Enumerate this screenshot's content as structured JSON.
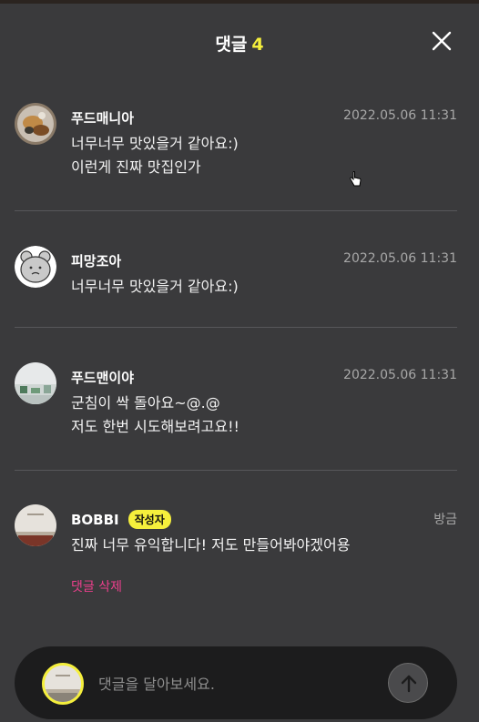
{
  "header": {
    "title": "댓글",
    "count": "4"
  },
  "comments": [
    {
      "author": "푸드매니아",
      "time": "2022.05.06 11:31",
      "lines": [
        "너무너무 맛있을거 같아요:)",
        "이런게 진짜 맛집인가"
      ],
      "avatar": "food-photo"
    },
    {
      "author": "피망조아",
      "time": "2022.05.06 11:31",
      "lines": [
        "너무너무 맛있을거 같아요:)"
      ],
      "avatar": "bear-character"
    },
    {
      "author": "푸드맨이야",
      "time": "2022.05.06 11:31",
      "lines": [
        "군침이 싹 돌아요~@.@",
        "저도 한번 시도해보려고요!!"
      ],
      "avatar": "kitchen-photo"
    },
    {
      "author": "BOBBI",
      "badge": "작성자",
      "time": "방금",
      "lines": [
        "진짜 너무 유익합니다! 저도 만들어봐야겠어용"
      ],
      "delete_label": "댓글 삭제",
      "avatar": "room-photo"
    }
  ],
  "input": {
    "placeholder": "댓글을 달아보세요."
  },
  "colors": {
    "accent": "#f5ef3c",
    "delete": "#ec3f8c",
    "background": "#3a3a3c"
  }
}
